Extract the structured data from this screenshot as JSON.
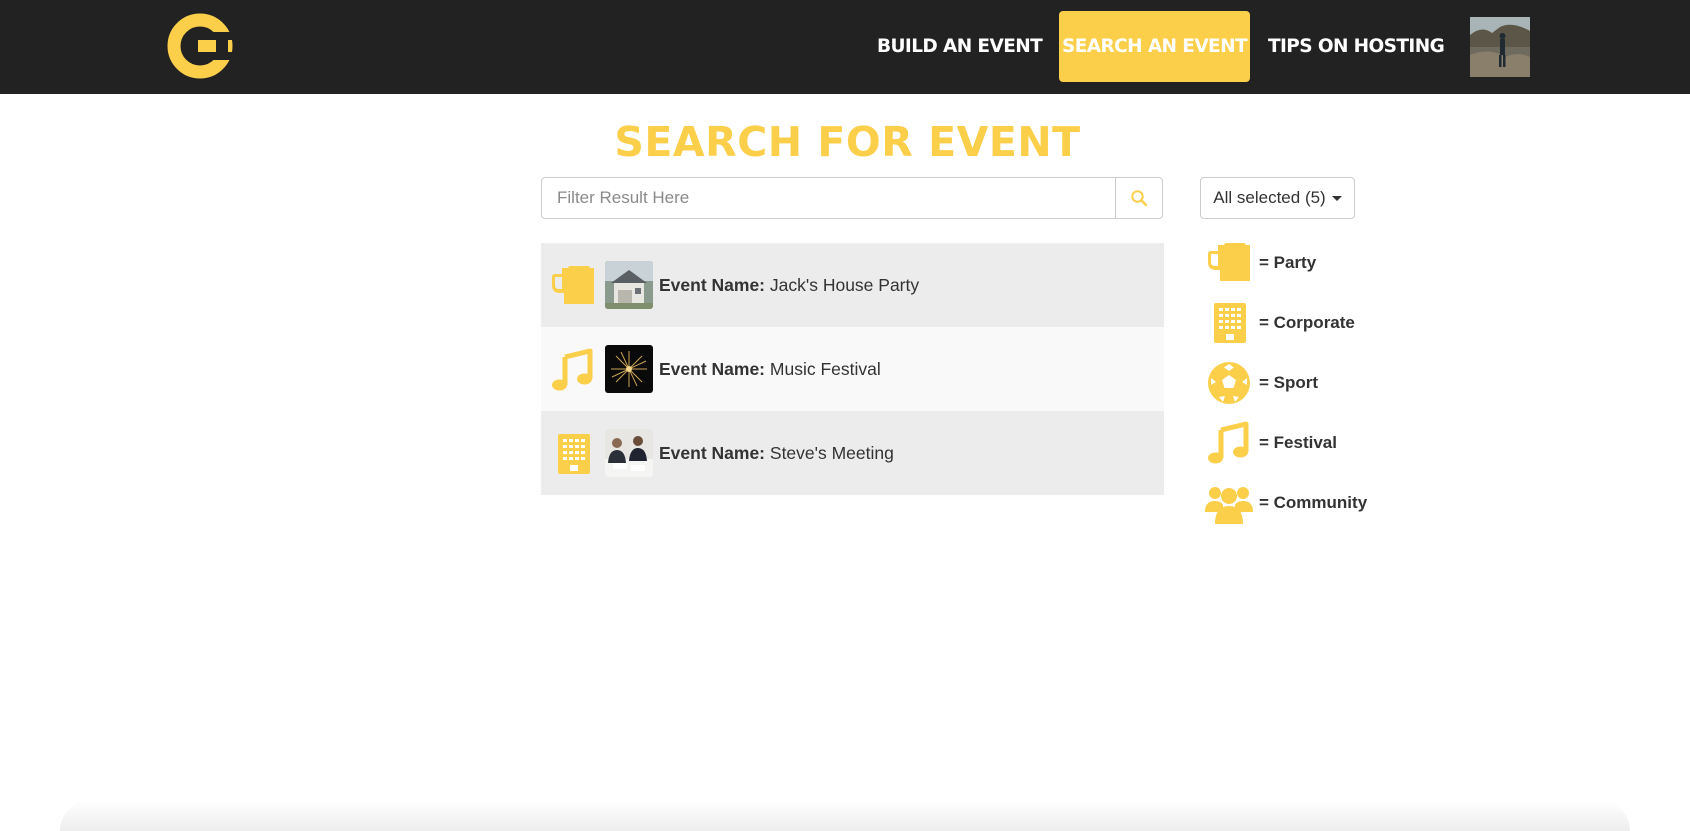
{
  "colors": {
    "accent": "#fbcf4a",
    "navbar_bg": "#222222"
  },
  "navbar": {
    "logo_icon": "brand-logo-icon",
    "links": [
      {
        "label": "BUILD AN EVENT",
        "active": false
      },
      {
        "label": "SEARCH AN EVENT",
        "active": true
      },
      {
        "label": "TIPS ON HOSTING",
        "active": false
      }
    ],
    "avatar_icon": "user-avatar-photo"
  },
  "page": {
    "title": "SEARCH FOR EVENT"
  },
  "search": {
    "placeholder": "Filter Result Here",
    "value": "",
    "button_icon": "search-icon"
  },
  "filter": {
    "label": "All selected (5)"
  },
  "events": [
    {
      "prefix": "Event Name:",
      "name": "Jack's House Party",
      "type": "party",
      "type_icon": "beer-mug-icon",
      "thumbnail": "house-photo"
    },
    {
      "prefix": "Event Name:",
      "name": "Music Festival",
      "type": "festival",
      "type_icon": "music-note-icon",
      "thumbnail": "fireworks-photo"
    },
    {
      "prefix": "Event Name:",
      "name": "Steve's Meeting",
      "type": "corporate",
      "type_icon": "building-icon",
      "thumbnail": "meeting-photo"
    }
  ],
  "legend": [
    {
      "label": "= Party",
      "icon": "beer-mug-icon"
    },
    {
      "label": "= Corporate",
      "icon": "building-icon"
    },
    {
      "label": "= Sport",
      "icon": "soccer-ball-icon"
    },
    {
      "label": "= Festival",
      "icon": "music-note-icon"
    },
    {
      "label": "= Community",
      "icon": "people-group-icon"
    }
  ]
}
